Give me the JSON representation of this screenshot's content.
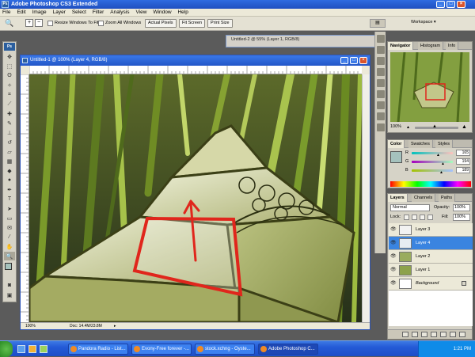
{
  "app": {
    "title": "Adobe Photoshop CS3 Extended",
    "logo": "Ps",
    "window_buttons": [
      "_",
      "□",
      "×"
    ]
  },
  "menu": [
    "File",
    "Edit",
    "Image",
    "Layer",
    "Select",
    "Filter",
    "Analysis",
    "View",
    "Window",
    "Help"
  ],
  "options": {
    "resize_windows_label": "Resize Windows To Fit",
    "zoom_all_label": "Zoom All Windows",
    "actual_pixels": "Actual Pixels",
    "fit_screen": "Fit Screen",
    "print_size": "Print Size",
    "workspace": "Workspace ▾"
  },
  "bg_document": {
    "title": "Untitled-2 @ 55% (Layer 1, RGB/8)"
  },
  "document": {
    "title": "Untitled-1 @ 100% (Layer 4, RGB/8)",
    "zoom": "100%",
    "doc_size": "Doc: 14.4M/23.8M"
  },
  "navigator": {
    "tabs": [
      "Navigator",
      "Histogram",
      "Info"
    ],
    "zoom": "100%"
  },
  "color": {
    "tabs": [
      "Color",
      "Swatches",
      "Styles"
    ],
    "channels": [
      {
        "label": "R",
        "value": "165",
        "level": 0.65
      },
      {
        "label": "G",
        "value": "194",
        "level": 0.76
      },
      {
        "label": "B",
        "value": "189",
        "level": 0.74
      }
    ],
    "foreground": "#a5c2bd"
  },
  "layers": {
    "tabs": [
      "Layers",
      "Channels",
      "Paths"
    ],
    "blend_mode": "Normal",
    "opacity_label": "Opacity:",
    "opacity": "100%",
    "lock_label": "Lock:",
    "fill_label": "Fill:",
    "fill": "100%",
    "items": [
      {
        "name": "Layer 3",
        "selected": false
      },
      {
        "name": "Layer 4",
        "selected": true
      },
      {
        "name": "Layer 2",
        "selected": false
      },
      {
        "name": "Layer 1",
        "selected": false
      },
      {
        "name": "Background",
        "selected": false
      }
    ],
    "footer_icons": [
      "link-icon",
      "fx-icon",
      "mask-icon",
      "adjustment-icon",
      "folder-icon",
      "new-layer-icon",
      "trash-icon"
    ]
  },
  "taskbar": {
    "items": [
      {
        "label": "Pandora Radio - List...",
        "active": false
      },
      {
        "label": "Evony-Free forever -...",
        "active": false
      },
      {
        "label": "stock.xchng - Oyste...",
        "active": false
      },
      {
        "label": "Adobe Photoshop C...",
        "active": true
      }
    ],
    "clock": "1:21 PM"
  }
}
